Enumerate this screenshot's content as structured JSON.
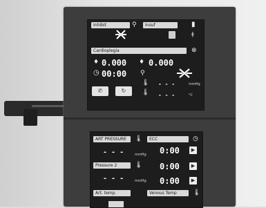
{
  "screen_top": {
    "left_dropdown": "Inhibit",
    "right_dropdown": "Insuf",
    "section_label": "Cardioplegia",
    "volume_left": "0.000",
    "volume_right": "0.000",
    "timer": "00:00",
    "dashes_top": "- - -",
    "dashes_bottom": "- - -",
    "unit_top": "mmHg",
    "unit_bottom": "°C"
  },
  "screen_bottom": {
    "art_pressure_label": "ART PRESSURE",
    "art_pressure_value": "- - -",
    "art_pressure_unit": "mmHg",
    "ecc_label": "ECC",
    "timer_1": "0:00",
    "timer_2": "0:00",
    "timer_3": "0:00",
    "pressure2_label": "Pressure 2",
    "pressure2_value": "- - -",
    "pressure2_unit": "mmHg",
    "art_temp_label": "Art. temp.",
    "venous_temp_label": "Venous Temp"
  },
  "icons": [
    "disconnected-icon",
    "battery-icon",
    "timer-icon",
    "clock-icon",
    "thermometer-icon",
    "play-icon",
    "phone-icon",
    "return-icon",
    "chevron-down-icon"
  ]
}
